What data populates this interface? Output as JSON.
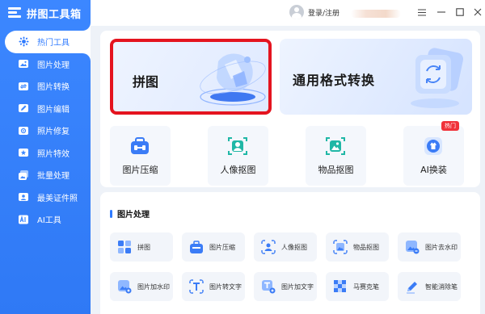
{
  "app": {
    "title": "拼图工具箱"
  },
  "topbar": {
    "login_label": "登录/注册",
    "window_buttons": [
      "menu-icon",
      "minimize-icon",
      "maximize-icon",
      "close-icon"
    ]
  },
  "sidebar": {
    "items": [
      {
        "label": "热门工具",
        "icon": "hot-icon",
        "active": true
      },
      {
        "label": "图片处理",
        "icon": "image-icon"
      },
      {
        "label": "图片转换",
        "icon": "convert-icon"
      },
      {
        "label": "图片编辑",
        "icon": "edit-icon"
      },
      {
        "label": "照片修复",
        "icon": "repair-icon"
      },
      {
        "label": "照片特效",
        "icon": "effect-icon"
      },
      {
        "label": "批量处理",
        "icon": "batch-icon"
      },
      {
        "label": "最美证件照",
        "icon": "id-photo-icon"
      },
      {
        "label": "AI工具",
        "icon": "ai-icon"
      }
    ]
  },
  "hot": {
    "banners": [
      {
        "label": "拼图",
        "highlighted": true
      },
      {
        "label": "通用格式转换"
      }
    ],
    "tools": [
      {
        "label": "图片压缩",
        "icon": "compress-icon"
      },
      {
        "label": "人像抠图",
        "icon": "portrait-cutout-icon"
      },
      {
        "label": "物品抠图",
        "icon": "object-cutout-icon"
      },
      {
        "label": "AI换装",
        "icon": "ai-outfit-icon",
        "badge": "热门"
      }
    ]
  },
  "image_processing": {
    "title": "图片处理",
    "items": [
      {
        "label": "拼图"
      },
      {
        "label": "图片压缩"
      },
      {
        "label": "人像抠图"
      },
      {
        "label": "物品抠图"
      },
      {
        "label": "图片去水印"
      },
      {
        "label": "图片加水印"
      },
      {
        "label": "图片转文字"
      },
      {
        "label": "图片加文字"
      },
      {
        "label": "马赛克笔"
      },
      {
        "label": "智能消除笔"
      }
    ]
  },
  "colors": {
    "accent": "#2f7bff",
    "sidebar": "#3c87ff",
    "highlight_border": "#e4141f",
    "badge": "#f0323a"
  }
}
